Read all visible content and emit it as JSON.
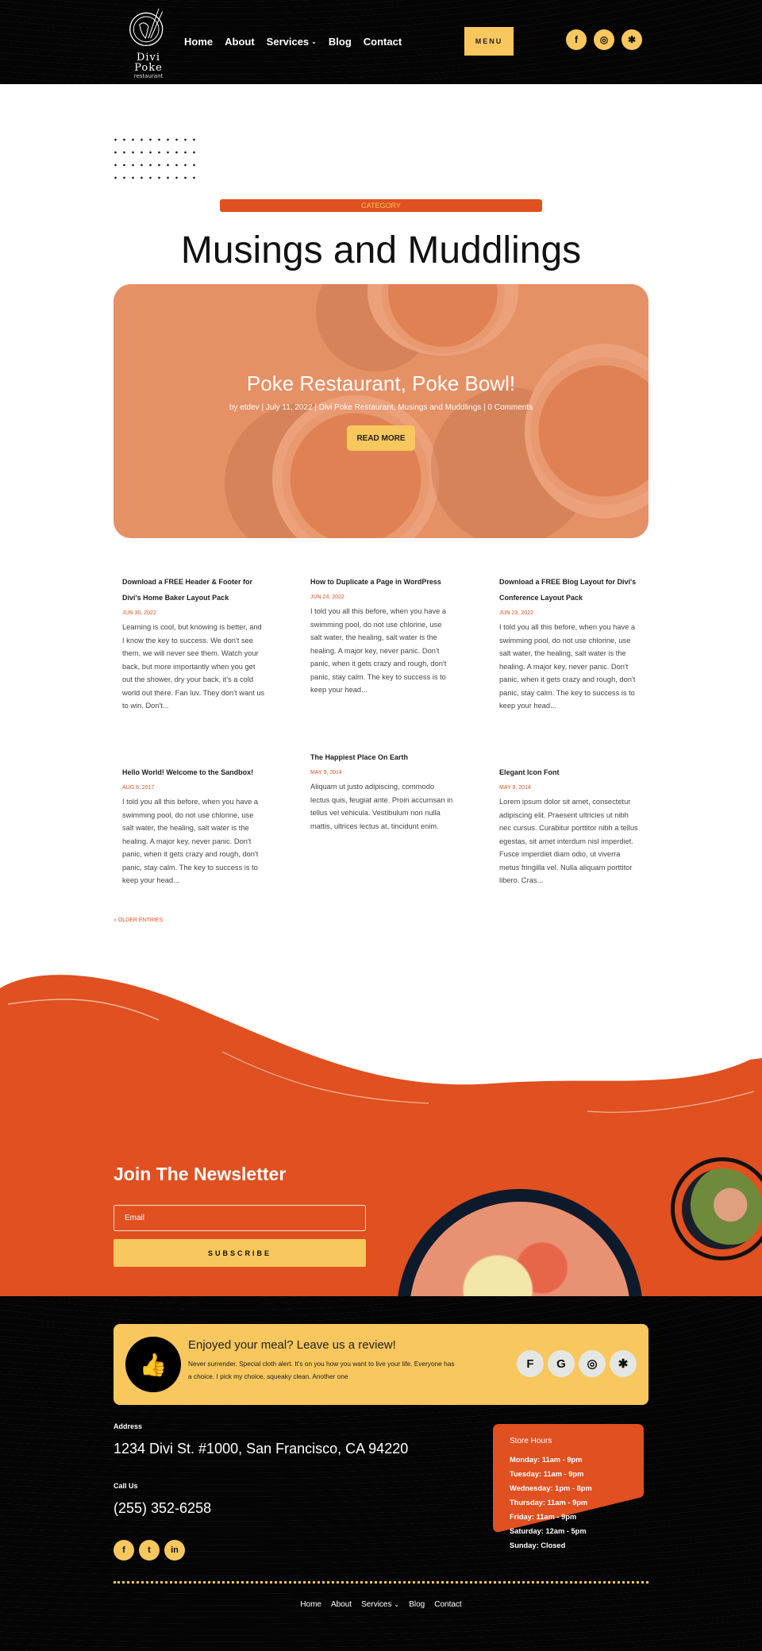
{
  "header": {
    "logo": {
      "name": "Divi Poke",
      "sub": "restaurant"
    },
    "nav": [
      {
        "label": "Home"
      },
      {
        "label": "About"
      },
      {
        "label": "Services",
        "dropdown": true
      },
      {
        "label": "Blog"
      },
      {
        "label": "Contact"
      }
    ],
    "menu_button": "MENU",
    "social": [
      {
        "icon": "facebook-icon",
        "glyph": "f"
      },
      {
        "icon": "tripadvisor-icon",
        "glyph": "◎"
      },
      {
        "icon": "yelp-icon",
        "glyph": "✱"
      }
    ]
  },
  "category_label": "CATEGORY",
  "page_title": "Musings and Muddlings",
  "featured": {
    "title": "Poke Restaurant, Poke Bowl!",
    "meta": "by etdev | July 11, 2022 | Divi Poke Restaurant, Musings and Muddlings | 0 Comments",
    "button": "READ MORE"
  },
  "posts": [
    {
      "title": "Download a FREE Header & Footer for Divi's Home Baker Layout Pack",
      "date": "JUN 30, 2022",
      "excerpt": "Learning is cool, but knowing is better, and I know the key to success. We don't see them, we will never see them. Watch your back, but more importantly when you get out the shower, dry your back, it's a cold world out there. Fan luv. They don't want us to win. Don't..."
    },
    {
      "title": "How to Duplicate a Page in WordPress",
      "date": "JUN 24, 2022",
      "excerpt": "I told you all this before, when you have a swimming pool, do not use chlorine, use salt water, the healing, salt water is the healing. A major key, never panic. Don't panic, when it gets crazy and rough, don't panic, stay calm. The key to success is to keep your head..."
    },
    {
      "title": "Download a FREE Blog Layout for Divi's Conference Layout Pack",
      "date": "JUN 23, 2022",
      "excerpt": "I told you all this before, when you have a swimming pool, do not use chlorine, use salt water, the healing, salt water is the healing. A major key, never panic. Don't panic, when it gets crazy and rough, don't panic, stay calm. The key to success is to keep your head..."
    },
    {
      "title": "Hello World! Welcome to the Sandbox!",
      "date": "AUG 6, 2017",
      "excerpt": "I told you all this before, when you have a swimming pool, do not use chlorine, use salt water, the healing, salt water is the healing. A major key, never panic. Don't panic, when it gets crazy and rough, don't panic, stay calm. The key to success is to keep your head..."
    },
    {
      "title": "The Happiest Place On Earth",
      "date": "MAY 9, 2014",
      "excerpt": "Aliquam ut justo adipiscing, commodo lectus quis, feugiat ante. Proin accumsan in tellus vel vehicula. Vestibulum non nulla mattis, ultrices lectus at, tincidunt enim."
    },
    {
      "title": "Elegant Icon Font",
      "date": "MAY 9, 2014",
      "excerpt": "Lorem ipsum dolor sit amet, consectetur adipiscing elit. Praesent ultricies ut nibh nec cursus. Curabitur porttitor nibh a tellus egestas, sit amet interdum nisl imperdiet. Fusce imperdiet diam odio, ut viverra metus fringilla vel. Nulla aliquam porttitor libero. Cras..."
    }
  ],
  "older_entries": "« OLDER ENTRIES",
  "newsletter": {
    "title": "Join The Newsletter",
    "email_placeholder": "Email",
    "email_value": "",
    "button": "SUBSCRIBE"
  },
  "review": {
    "title": "Enjoyed your meal? Leave us a review!",
    "text": "Never surrender. Special cloth alert. It's on you how you want to live your life. Everyone has a choice. I pick my choice, squeaky clean. Another one",
    "icons": [
      {
        "icon": "foursquare-icon",
        "glyph": "F"
      },
      {
        "icon": "google-icon",
        "glyph": "G"
      },
      {
        "icon": "tripadvisor-icon",
        "glyph": "◎"
      },
      {
        "icon": "yelp-icon",
        "glyph": "✱"
      }
    ]
  },
  "footer": {
    "address_label": "Address",
    "address": "1234 Divi St. #1000, San Francisco, CA 94220",
    "call_label": "Call Us",
    "phone": "(255) 352-6258",
    "social": [
      {
        "icon": "facebook-icon",
        "glyph": "f"
      },
      {
        "icon": "twitter-icon",
        "glyph": "t"
      },
      {
        "icon": "linkedin-icon",
        "glyph": "in"
      }
    ],
    "hours_title": "Store Hours",
    "hours": [
      "Monday: 11am - 9pm",
      "Tuesday: 11am - 9pm",
      "Wednesday: 1pm - 8pm",
      "Thursday: 11am - 9pm",
      "Friday: 11am - 9pm",
      "Saturday: 12am - 5pm",
      "Sunday: Closed"
    ],
    "nav": [
      {
        "label": "Home"
      },
      {
        "label": "About"
      },
      {
        "label": "Services",
        "dropdown": true
      },
      {
        "label": "Blog"
      },
      {
        "label": "Contact"
      }
    ]
  },
  "colors": {
    "accent_orange": "#e05020",
    "accent_yellow": "#f8c75d",
    "dark": "#050505"
  }
}
